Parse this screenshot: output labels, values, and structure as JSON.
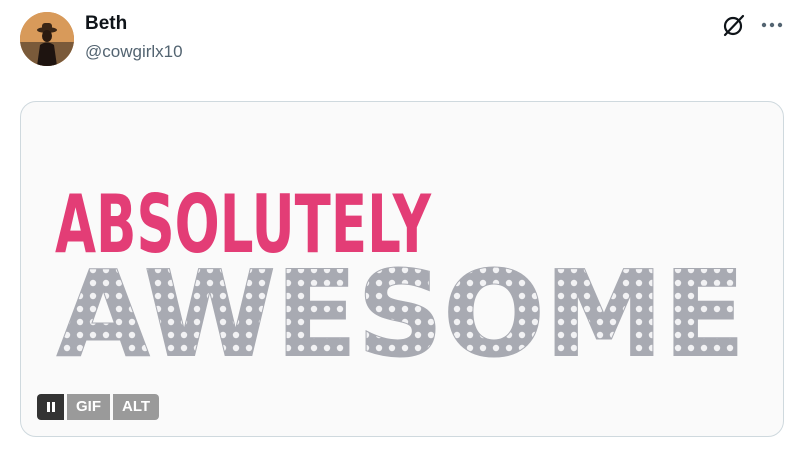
{
  "post": {
    "display_name": "Beth",
    "handle": "@cowgirlx10",
    "avatar_alt": "avatar-photo"
  },
  "icons": {
    "grok": "grok-icon",
    "more": "more-dots-icon",
    "pause": "pause-icon"
  },
  "media": {
    "line1": "ABSOLUTELY",
    "line2": "AWESOME",
    "gif_badge": "GIF",
    "alt_badge": "ALT"
  },
  "colors": {
    "line1": "#e33d76",
    "line2": "#a8aab2",
    "bulb": "#ffffff"
  }
}
